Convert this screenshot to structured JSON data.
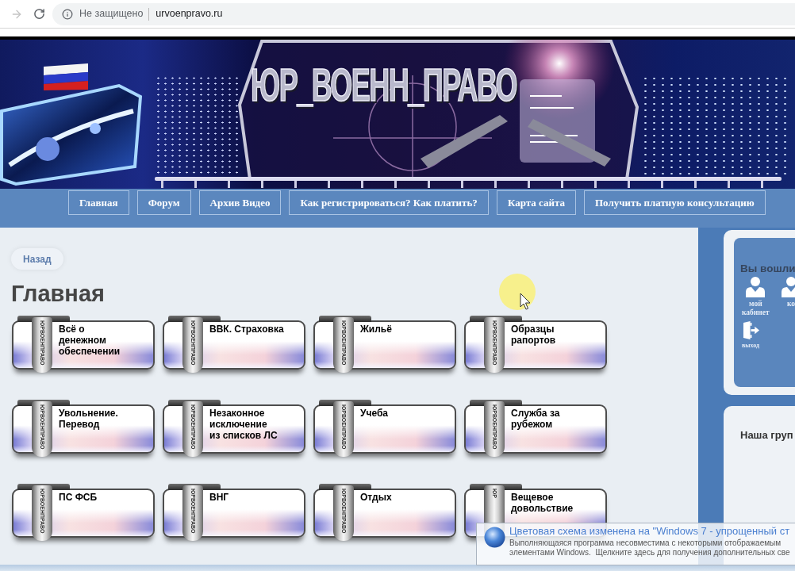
{
  "browser": {
    "security_label": "Не защищено",
    "url": "urvoenpravo.ru"
  },
  "banner": {
    "title": "ЮР_ВОЕНН_ПРАВО"
  },
  "nav": [
    {
      "label": "Главная"
    },
    {
      "label": "Форум"
    },
    {
      "label": "Архив Видео"
    },
    {
      "label": "Как регистрироваться? Как платить?"
    },
    {
      "label": "Карта сайта"
    },
    {
      "label": "Получить платную консультацию"
    }
  ],
  "back_button": {
    "label": "Назад"
  },
  "page_title": "Главная",
  "tiles": [
    {
      "label": "Всё о\nденежном\nобеспечении",
      "strap_label": "ЮРВОЕНПРАВО"
    },
    {
      "label": "ВВК. Страховка",
      "strap_label": "ЮРВОЕНПРАВО"
    },
    {
      "label": "Жильё",
      "strap_label": "ЮРВОЕНПРАВО"
    },
    {
      "label": "Образцы\nрапортов",
      "strap_label": "ЮРВОЕНПРАВО"
    },
    {
      "label": "Увольнение.\nПеревод",
      "strap_label": "ЮРВОЕНПРАВО"
    },
    {
      "label": "Незаконное\nисключение\nиз списков ЛС",
      "strap_label": "ЮРВОЕНПРАВО"
    },
    {
      "label": "Учеба",
      "strap_label": "ЮРВОЕНПРАВО"
    },
    {
      "label": "Служба за\nрубежом",
      "strap_label": "ЮРВОЕНПРАВО"
    },
    {
      "label": "ПС ФСБ",
      "strap_label": "ЮРВОЕНПРАВО"
    },
    {
      "label": "ВНГ",
      "strap_label": "ЮРВОЕНПРАВО"
    },
    {
      "label": "Отдых",
      "strap_label": "ЮРВОЕНПРАВО"
    },
    {
      "label": "Вещевое\nдовольствие",
      "strap_label": "ЮР"
    }
  ],
  "sidebar": {
    "login_card": {
      "title": "Вы вошли",
      "items": [
        {
          "kind": "user",
          "label": "мой\nкабинет"
        },
        {
          "kind": "user",
          "label": "ко"
        },
        {
          "kind": "exit",
          "label": "выход"
        }
      ]
    },
    "group_card": {
      "title": "Наша груп"
    }
  },
  "notification": {
    "title": "Цветовая схема изменена на \"Windows 7 - упрощенный ст",
    "body": "Выполняющаяся программа несовместима с некоторыми отображаемым\nэлементами Windows.  Щелкните здесь для получения дополнительных све"
  }
}
